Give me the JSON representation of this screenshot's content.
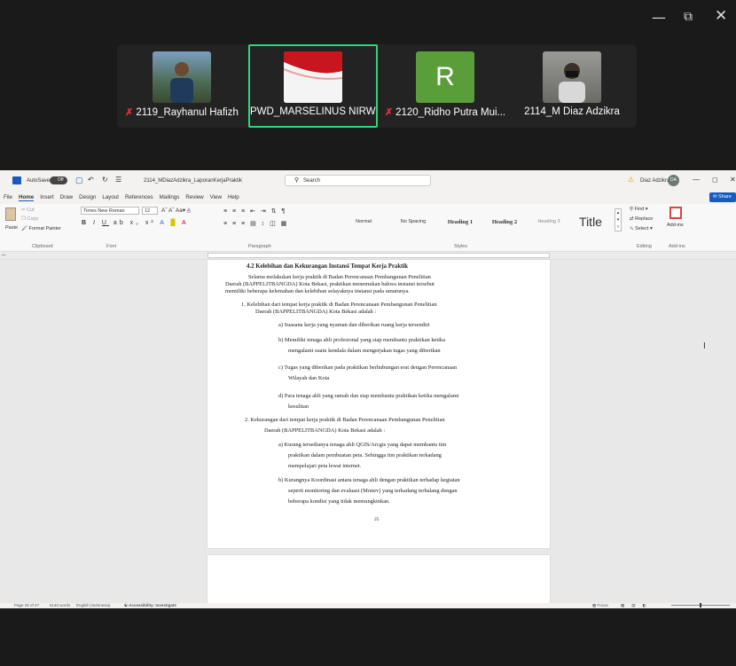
{
  "zoom_window": {
    "minimize_icon": "minimize-icon",
    "restore_icon": "restore-icon",
    "close_icon": "close-icon"
  },
  "gallery": [
    {
      "name": "2119_Rayhanul Hafizh",
      "muted": true
    },
    {
      "name": "PWD_MARSELINUS NIRW...",
      "muted": false,
      "active": true
    },
    {
      "name": "2120_Ridho Putra Mui...",
      "muted": true,
      "initial": "R",
      "tile_color": "#5a9e3a"
    },
    {
      "name": "2114_M Diaz Adzikra",
      "muted": false
    }
  ],
  "word": {
    "autosave": "AutoSave",
    "autosave_state": "Off",
    "filename": "2114_MDiazAdzikra_LaporanKerjaPraktik",
    "search": "Search",
    "user": "Diaz Adzikra",
    "user_initials": "DA",
    "share": "Share",
    "menu": [
      "File",
      "Home",
      "Insert",
      "Draw",
      "Design",
      "Layout",
      "References",
      "Mailings",
      "Review",
      "View",
      "Help"
    ],
    "ribbon": {
      "paste": "Paste",
      "cut": "Cut",
      "copy": "Copy",
      "format_painter": "Format Painter",
      "clipboard": "Clipboard",
      "font_name": "Times New Roman",
      "font_size": "12",
      "font_group": "Font",
      "paragraph_group": "Paragraph",
      "styles_group": "Styles",
      "styles": [
        "Normal",
        "No Spacing",
        "Heading 1",
        "Heading 2",
        "Heading 3",
        "Title"
      ],
      "find": "Find",
      "replace": "Replace",
      "select": "Select",
      "editing": "Editing",
      "addins": "Add-ins"
    },
    "status": {
      "page": "Page 29 of 47",
      "words": "6140 words",
      "language": "English (Indonesia)",
      "accessibility": "Accessibility: Investigate",
      "focus": "Focus"
    }
  },
  "doc": {
    "heading": "4.2 Kelebihan dan Kekurangan Instansi Tempat Kerja Praktik",
    "intro": [
      "Selama melakukan kerja praktik di Badan Perencanaan Pembangunan Penelitian",
      "Daerah (BAPPELITBANGDA) Kota Bekasi, praktikan menemukan bahwa instansi tersebut",
      "memiliki beberapa kelemahan dan kelebihan selayaknya instansi pada umumnya."
    ],
    "item1": [
      "1.   Kelebihan dari tempat kerja praktik di Badan Perencanaan Pembangunan Penelitian",
      "Daerah (BAPPELITBANGDA) Kota Bekasi adalah :"
    ],
    "item1_sub": [
      [
        "a)  Suasana kerja yang nyaman dan diberikan ruang kerja tersendiri"
      ],
      [
        "b)  Memiliki tenaga ahli profesional yang siap membantu praktikan ketika",
        "mengalami suatu kendala dalam mengerjakan tugas yang diberikan"
      ],
      [
        "c)  Tugas yang diberikan pada praktikan berhubungan erat dengan Perencanaan",
        "Wilayah dan Kota"
      ],
      [
        "d)  Para tenaga ahli yang ramah dan siap membantu praktikan ketika mengalami",
        "kesulitan"
      ]
    ],
    "item2": [
      "2. Kekurangan dari tempat kerja praktik di Badan Perencanaan Pembangunan Penelitian",
      "Daerah (BAPPELITBANGDA) Kota Bekasi adalah :"
    ],
    "item2_sub": [
      [
        "a)  Kurang tersedianya tenaga ahli QGIS/Arcgis yang dapat membantu tim",
        "praktikan dalam pembuatan peta. Sehingga tim praktikan terkadang",
        "mempelajari peta lewat internet."
      ],
      [
        "b)  Kurangnya Koordinasi antara tenaga ahli dengan praktikan terhadap kegiatan",
        "seperti monitoring dan evaluasi (Monev) yang terkadang terhalang dengan",
        "beberapa kondisi yang tidak memungkinkan."
      ]
    ],
    "page_number": "25"
  }
}
